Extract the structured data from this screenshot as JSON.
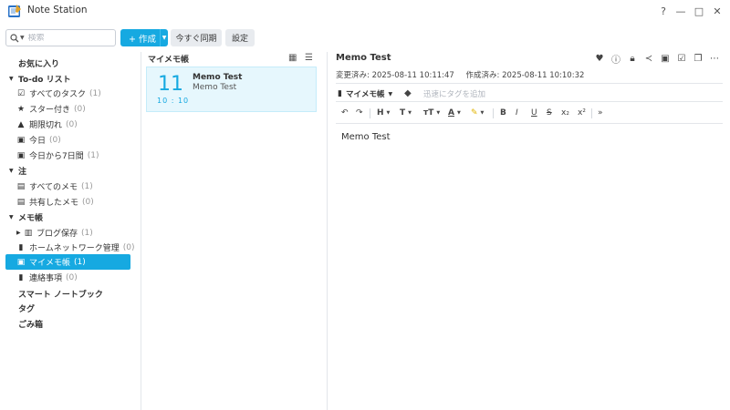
{
  "window": {
    "title": "Note Station",
    "help_label": "?",
    "minimize_label": "—",
    "maximize_label": "□",
    "close_label": "✕"
  },
  "toolbar": {
    "search_placeholder": "検索",
    "create_label": "+ 作成",
    "sync_label": "今すぐ同期",
    "settings_label": "設定"
  },
  "sidebar": {
    "favorites": "お気に入り",
    "todo_header": "To-do リスト",
    "all_tasks": {
      "label": "すべてのタスク",
      "count": "(1)"
    },
    "starred": {
      "label": "スター付き",
      "count": "(0)"
    },
    "overdue": {
      "label": "期限切れ",
      "count": "(0)"
    },
    "today": {
      "label": "今日",
      "count": "(0)"
    },
    "next7": {
      "label": "今日から7日間",
      "count": "(1)"
    },
    "notes_header": "注",
    "all_notes": {
      "label": "すべてのメモ",
      "count": "(1)"
    },
    "shared_notes": {
      "label": "共有したメモ",
      "count": "(0)"
    },
    "notebooks_header": "メモ帳",
    "blog": {
      "label": "ブログ保存",
      "count": "(1)"
    },
    "home_network": {
      "label": "ホームネットワーク管理",
      "count": "(0)"
    },
    "my_notebook": {
      "label": "マイメモ帳",
      "count": "(1)"
    },
    "contacts": {
      "label": "連絡事項",
      "count": "(0)"
    },
    "smart_notebook": "スマート ノートブック",
    "tags": "タグ",
    "trash": "ごみ箱"
  },
  "note_list": {
    "header": "マイメモ帳",
    "notes": [
      {
        "day": "11",
        "time": "10 : 10",
        "title": "Memo Test",
        "snippet": "Memo Test"
      }
    ]
  },
  "editor": {
    "title": "Memo Test",
    "modified": "変更済み: 2025-08-11 10:11:47",
    "created": "作成済み: 2025-08-11 10:10:32",
    "notebook": "マイメモ帳",
    "tag_placeholder": "迅速にタグを追加",
    "body": "Memo Test",
    "format_labels": {
      "heading": "H",
      "font": "T",
      "font_size": "тT",
      "font_color": "A",
      "bold": "B",
      "italic": "I",
      "underline": "U",
      "strike": "S",
      "subscript": "x₂",
      "superscript": "x²"
    }
  },
  "colors": {
    "accent": "#16a9e1",
    "selected_bg": "#e6f7fd"
  }
}
